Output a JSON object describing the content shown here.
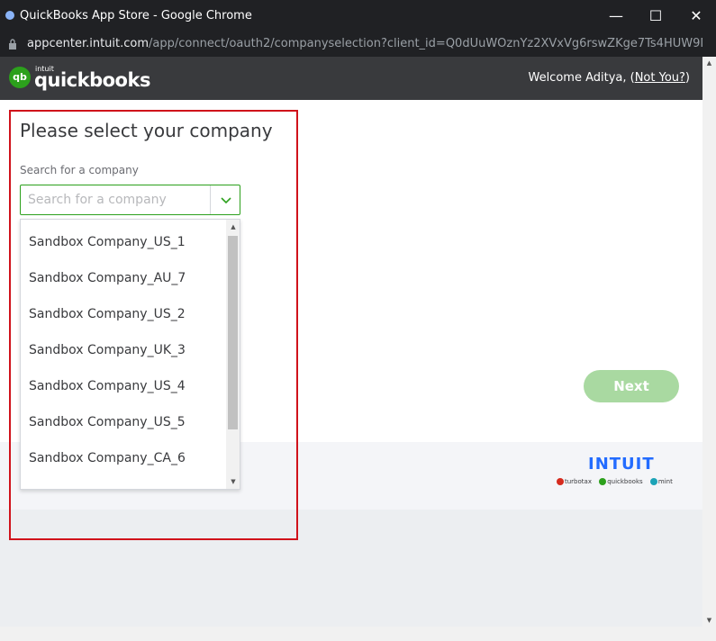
{
  "browser": {
    "window_title": "QuickBooks App Store - Google Chrome",
    "minimize_glyph": "—",
    "maximize_glyph": "☐",
    "close_glyph": "✕",
    "url_host": "appcenter.intuit.com",
    "url_path": "/app/connect/oauth2/companyselection?client_id=Q0dUuWOznYz2XVxVg6rswZKge7Ts4HUW9M1..."
  },
  "header": {
    "logo_mark": "qb",
    "logo_intuit": "intuit",
    "logo_text": "quickbooks",
    "welcome_text": "Welcome Aditya, (",
    "not_you_label": "Not You?",
    "welcome_suffix": ")"
  },
  "page": {
    "title": "Please select your company",
    "search_label": "Search for a company",
    "search_placeholder": "Search for a company",
    "search_value": ""
  },
  "companies": [
    "Sandbox Company_US_1",
    "Sandbox Company_AU_7",
    "Sandbox Company_US_2",
    "Sandbox Company_UK_3",
    "Sandbox Company_US_4",
    "Sandbox Company_US_5",
    "Sandbox Company_CA_6"
  ],
  "actions": {
    "next_label": "Next"
  },
  "footer": {
    "intuit_logo": "INTUIT",
    "brands": [
      "turbotax",
      "quickbooks",
      "mint"
    ]
  },
  "colors": {
    "accent_green": "#2ca01c",
    "next_disabled": "#a9d9a1",
    "header_dark": "#393a3d",
    "highlight_red": "#d0121b",
    "intuit_blue": "#236cff"
  }
}
